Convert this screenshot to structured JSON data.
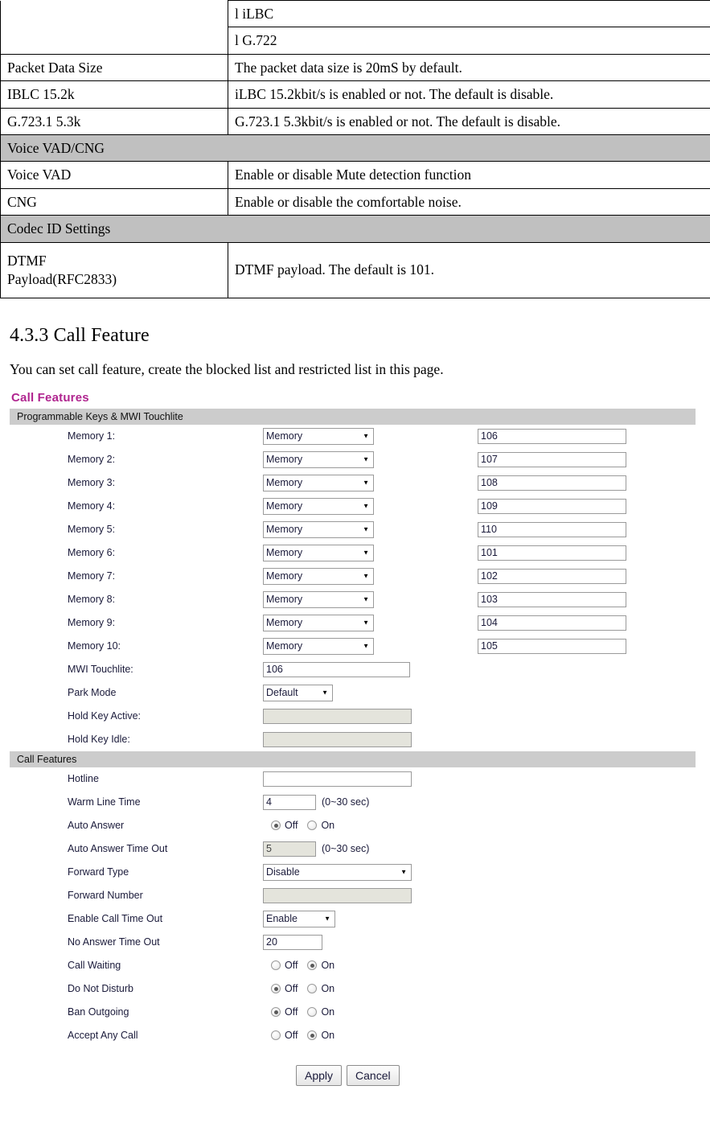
{
  "doc_table": {
    "rows": [
      {
        "type": "codec-bullet",
        "label": "",
        "value": "l  iLBC"
      },
      {
        "type": "codec-bullet",
        "label": "",
        "value": "l  G.722"
      },
      {
        "type": "normal",
        "label": "Packet Data Size",
        "value": "The packet data size is 20mS by default."
      },
      {
        "type": "normal",
        "label": "IBLC 15.2k",
        "value": "iLBC 15.2kbit/s is enabled or not. The default is disable."
      },
      {
        "type": "normal",
        "label": "G.723.1 5.3k",
        "value": "G.723.1 5.3kbit/s is enabled or not. The default is disable."
      },
      {
        "type": "section",
        "label": "Voice VAD/CNG",
        "value": ""
      },
      {
        "type": "normal",
        "label": "Voice VAD",
        "value": "Enable or disable Mute detection function"
      },
      {
        "type": "normal",
        "label": "CNG",
        "value": "Enable or disable the comfortable noise."
      },
      {
        "type": "section",
        "label": "Codec ID Settings",
        "value": ""
      },
      {
        "type": "tall",
        "label": "DTMF\nPayload(RFC2833)",
        "label_line1": "DTMF",
        "label_line2": "Payload(RFC2833)",
        "value": "DTMF payload. The default is 101."
      }
    ]
  },
  "heading": "4.3.3 Call Feature",
  "intro": "You can set call feature, create the blocked list and restricted list in this page.",
  "panel": {
    "title": "Call Features",
    "accent_color": "#b0258f",
    "section_bar_color": "#cccccc"
  },
  "programmable": {
    "bar_label": "Programmable Keys & MWI Touchlite",
    "memories": [
      {
        "label": "Memory 1:",
        "type": "Memory",
        "number": "106"
      },
      {
        "label": "Memory 2:",
        "type": "Memory",
        "number": "107"
      },
      {
        "label": "Memory 3:",
        "type": "Memory",
        "number": "108"
      },
      {
        "label": "Memory 4:",
        "type": "Memory",
        "number": "109"
      },
      {
        "label": "Memory 5:",
        "type": "Memory",
        "number": "110"
      },
      {
        "label": "Memory 6:",
        "type": "Memory",
        "number": "101"
      },
      {
        "label": "Memory 7:",
        "type": "Memory",
        "number": "102"
      },
      {
        "label": "Memory 8:",
        "type": "Memory",
        "number": "103"
      },
      {
        "label": "Memory 9:",
        "type": "Memory",
        "number": "104"
      },
      {
        "label": "Memory 10:",
        "type": "Memory",
        "number": "105"
      }
    ],
    "mwi_touchlite": {
      "label": "MWI Touchlite:",
      "value": "106"
    },
    "park_mode": {
      "label": "Park Mode",
      "value": "Default"
    },
    "hold_key_active": {
      "label": "Hold Key Active:",
      "value": "",
      "disabled": true
    },
    "hold_key_idle": {
      "label": "Hold Key Idle:",
      "value": "",
      "disabled": true
    }
  },
  "call_features": {
    "bar_label": "Call Features",
    "hotline": {
      "label": "Hotline",
      "value": ""
    },
    "warm_line_time": {
      "label": "Warm Line Time",
      "value": "4",
      "hint": "(0~30 sec)"
    },
    "auto_answer": {
      "label": "Auto Answer",
      "off_label": "Off",
      "on_label": "On",
      "selected": "Off"
    },
    "auto_answer_time_out": {
      "label": "Auto Answer Time Out",
      "value": "5",
      "hint": "(0~30 sec)",
      "disabled": true
    },
    "forward_type": {
      "label": "Forward Type",
      "value": "Disable"
    },
    "forward_number": {
      "label": "Forward Number",
      "value": "",
      "disabled": true
    },
    "enable_call_time_out": {
      "label": "Enable Call Time Out",
      "value": "Enable"
    },
    "no_answer_time_out": {
      "label": "No Answer Time Out",
      "value": "20"
    },
    "call_waiting": {
      "label": "Call Waiting",
      "off_label": "Off",
      "on_label": "On",
      "selected": "On"
    },
    "do_not_disturb": {
      "label": "Do Not Disturb",
      "off_label": "Off",
      "on_label": "On",
      "selected": "Off"
    },
    "ban_outgoing": {
      "label": "Ban Outgoing",
      "off_label": "Off",
      "on_label": "On",
      "selected": "Off"
    },
    "accept_any_call": {
      "label": "Accept Any Call",
      "off_label": "Off",
      "on_label": "On",
      "selected": "On"
    }
  },
  "buttons": {
    "apply": "Apply",
    "cancel": "Cancel"
  }
}
